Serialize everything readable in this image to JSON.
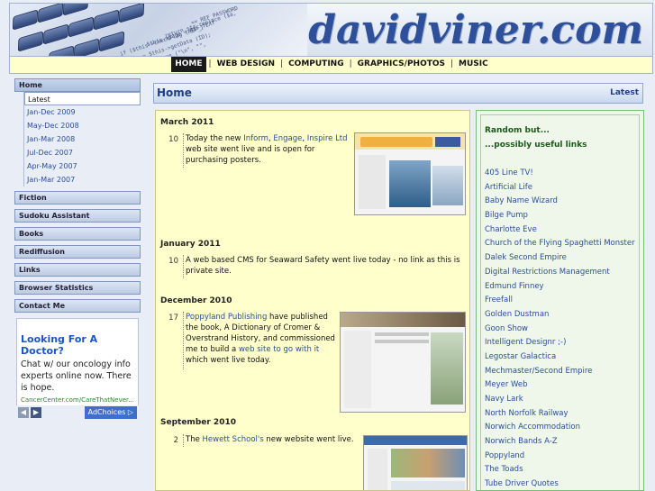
{
  "site": {
    "logo": "davidviner.com"
  },
  "topnav": [
    "HOME",
    "WEB DESIGN",
    "COMPUTING",
    "GRAPHICS/PHOTOS",
    "MUSIC"
  ],
  "sidebar": {
    "home": "Home",
    "sub": [
      "Latest",
      "Jan-Dec 2009",
      "May-Dec 2008",
      "Jan-Mar 2008",
      "Jul-Dec 2007",
      "Apr-May 2007",
      "Jan-Mar 2007"
    ],
    "sections": [
      "Fiction",
      "Sudoku Assistant",
      "Books",
      "Rediffusion",
      "Links",
      "Browser Statistics",
      "Contact Me"
    ]
  },
  "ad": {
    "title": "Looking For A Doctor?",
    "body": "Chat w/ our oncology info experts online now. There is hope.",
    "url": "CancerCenter.com/CareThatNever...",
    "adchoices": "AdChoices"
  },
  "main": {
    "title": "Home",
    "latest": "Latest"
  },
  "news": {
    "m1": "March 2011",
    "e1_num": "10",
    "e1_a": "Today the new ",
    "e1_l1": "Inform",
    "e1_c1": ", ",
    "e1_l2": "Engage",
    "e1_c2": ", ",
    "e1_l3": "Inspire Ltd",
    "e1_b": "web site went live and is open for purchasing posters.",
    "m2": "January 2011",
    "e2_num": "10",
    "e2": "A web based CMS for Seaward Safety went live today - no link as this is private site.",
    "m3": "December 2010",
    "e3_num": "17",
    "e3_l1": "Poppyland Publishing",
    "e3_a": " have published the book, A Dictionary of Cromer & Overstrand History, and commissioned me to build a ",
    "e3_l2": "web site to go with it",
    "e3_b": " which went live today.",
    "m4": "September 2010",
    "e4_num": "2",
    "e4_a": "The ",
    "e4_l": "Hewett School's",
    "e4_b": " new website went live."
  },
  "random": {
    "head1": "Random but...",
    "head2": "...possibly useful links",
    "links": [
      "405 Line TV!",
      "Artificial Life",
      "Baby Name Wizard",
      "Bilge Pump",
      "Charlotte Eve",
      "Church of the Flying Spaghetti Monster",
      "Dalek Second Empire",
      "Digital Restrictions Management",
      "Edmund Finney",
      "Freefall",
      "Golden Dustman",
      "Goon Show",
      "Intelligent Designr ;-)",
      "Legostar Galactica",
      "Mechmaster/Second Empire",
      "Meyer Web",
      "Navy Lark",
      "North Norfolk Railway",
      "Norwich Accommodation",
      "Norwich Bands A-Z",
      "Poppyland",
      "The Toads",
      "Tube Driver Quotes"
    ]
  }
}
